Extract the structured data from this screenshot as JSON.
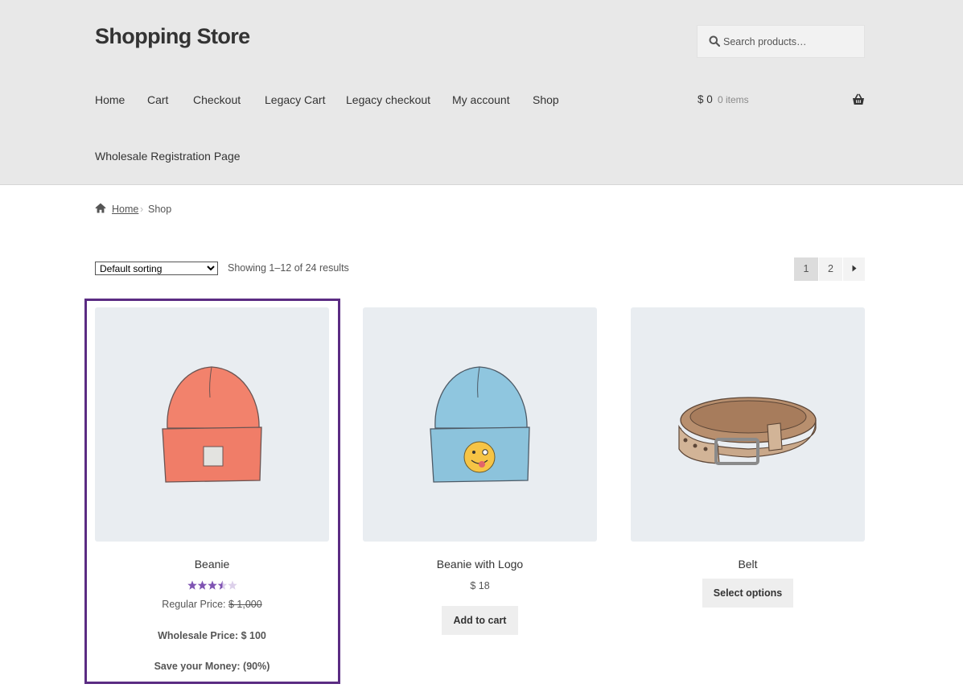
{
  "site": {
    "title": "Shopping Store"
  },
  "search": {
    "placeholder": "Search products…"
  },
  "nav": {
    "items": [
      "Home",
      "Cart",
      "Checkout",
      "Legacy Cart",
      "Legacy checkout",
      "My account",
      "Shop",
      "Wholesale Registration Page"
    ]
  },
  "cart": {
    "amount": "$ 0",
    "count": "0 items"
  },
  "breadcrumb": {
    "home": "Home",
    "separator": "›",
    "current": "Shop"
  },
  "sorting": {
    "selected": "Default sorting"
  },
  "results": {
    "text": "Showing 1–12 of 24 results"
  },
  "pagination": {
    "pages": [
      "1",
      "2"
    ],
    "current": "1",
    "next_icon": "caret-right-icon"
  },
  "products": [
    {
      "title": "Beanie",
      "rating": 3.5,
      "rating_max": 5,
      "regular_price_label": "Regular Price:",
      "regular_price": "$ 1,000",
      "wholesale_price": "Wholesale Price: $ 100",
      "savings": "Save your Money: (90%)"
    },
    {
      "title": "Beanie with Logo",
      "price": "$ 18",
      "button": "Add to cart"
    },
    {
      "title": "Belt",
      "button": "Select options"
    }
  ],
  "colors": {
    "header_bg": "#e8e8e8",
    "accent_purple": "#5b2c83",
    "star_color": "#7f54b3",
    "button_bg": "#eeeeee"
  }
}
